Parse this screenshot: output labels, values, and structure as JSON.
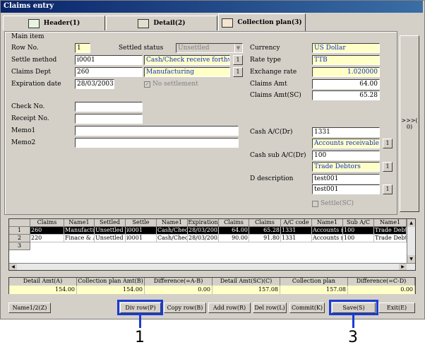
{
  "window": {
    "title": "Claims entry"
  },
  "tabs": [
    {
      "label": "Header(1)"
    },
    {
      "label": "Detail(2)"
    },
    {
      "label": "Collection plan(3)"
    }
  ],
  "main_item": {
    "legend": "Main item",
    "row_no": {
      "label": "Row No.",
      "value": "1"
    },
    "settled_status": {
      "label": "Settled status",
      "value": "Unsettled"
    },
    "settle_method": {
      "label": "Settle method",
      "code": "i0001",
      "name": "Cash/Check receive forthwith"
    },
    "claims_dept": {
      "label": "Claims Dept",
      "code": "260",
      "name": "Manufacturing"
    },
    "expiration_date": {
      "label": "Expiration date",
      "value": "28/03/2003"
    },
    "no_settlement": {
      "label": "No settlement"
    },
    "check_no": {
      "label": "Check No.",
      "value": ""
    },
    "receipt_no": {
      "label": "Receipt No.",
      "value": ""
    },
    "memo1": {
      "label": "Memo1",
      "value": ""
    },
    "memo2": {
      "label": "Memo2",
      "value": ""
    },
    "currency": {
      "label": "Currency",
      "value": "US Dollar"
    },
    "rate_type": {
      "label": "Rate type",
      "value": "TTB"
    },
    "exchange_rate": {
      "label": "Exchange rate",
      "value": "1.020000"
    },
    "claims_amt": {
      "label": "Claims Amt",
      "value": "64.00"
    },
    "claims_amt_sc": {
      "label": "Claims Amt(SC)",
      "value": "65.28"
    },
    "cash_ac": {
      "label": "Cash A/C(Dr)",
      "code": "1331",
      "name": "Accounts receivable-trade"
    },
    "cash_sub_ac": {
      "label": "Cash sub A/C(Dr)",
      "code": "100",
      "name": "Trade Debtors"
    },
    "d_description": {
      "label": "D description",
      "line1": "test001",
      "line2": "test001"
    },
    "settle_sc": {
      "label": "Settle(SC)"
    },
    "lookup_button": "1",
    "side_button": ">>>(\n0)"
  },
  "grid": {
    "columns": [
      "Claims",
      "Name1",
      "Settled",
      "Settle",
      "Name1",
      "Expiration",
      "Claims",
      "Claims",
      "A/C code",
      "Name1",
      "Sub A/C",
      "Name1"
    ],
    "rows": [
      {
        "num": "1",
        "cells": [
          "260",
          "Manufacturi",
          "Unsettled",
          "i0001",
          "Cash/Check",
          "28/03/2003",
          "64.00",
          "65.28",
          "1331",
          "Accounts re",
          "100",
          "Trade Debto"
        ]
      },
      {
        "num": "2",
        "cells": [
          "220",
          "Finace & Ac",
          "Unsettled",
          "i0001",
          "Cash/Check",
          "28/03/2003",
          "90.00",
          "91.80",
          "1331",
          "Accounts re",
          "100",
          "Trade Debto"
        ]
      },
      {
        "num": "3",
        "cells": [
          "",
          "",
          "",
          "",
          "",
          "",
          "",
          "",
          "",
          "",
          "",
          ""
        ]
      }
    ]
  },
  "summary": {
    "headers": [
      "Detail Amt(A)",
      "Collection plan Amt(B)",
      "Difference(=A-B)",
      "Detail Amt(SC)(C)",
      "Collection plan",
      "Difference(=C-D)"
    ],
    "values": [
      "154.00",
      "154.00",
      "0.00",
      "157.08",
      "157.08",
      "0.00"
    ]
  },
  "buttons": {
    "name12": "Name1/2(Z)",
    "div_row": "Div row(P)",
    "copy_row": "Copy row(B)",
    "add_row": "Add row(R)",
    "del_row": "Del row(L)",
    "commit": "Commit(K)",
    "save": "Save(S)",
    "exit": "Exit(E)"
  },
  "callouts": {
    "one": "1",
    "three": "3"
  },
  "colors": {
    "highlight": "#1a3bd6",
    "title_bar": "#0a246a",
    "field_yellow": "#ffffc8",
    "selected_row": "#000000"
  }
}
